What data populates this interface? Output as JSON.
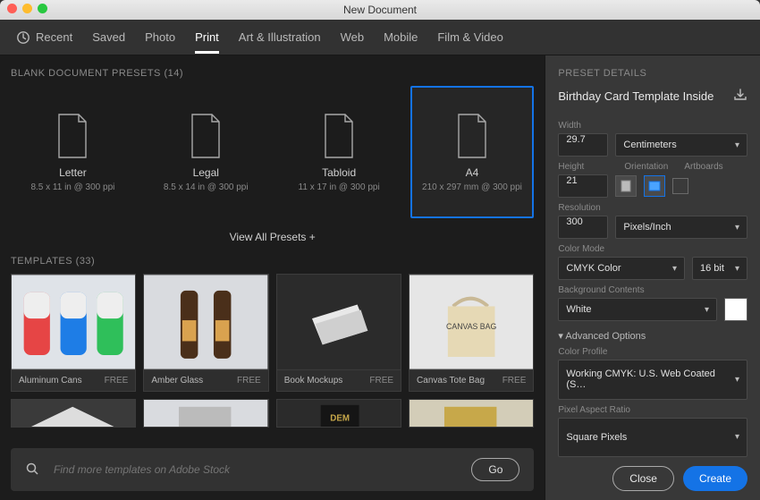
{
  "window": {
    "title": "New Document"
  },
  "tabs": {
    "recent": "Recent",
    "saved": "Saved",
    "photo": "Photo",
    "print": "Print",
    "art": "Art & Illustration",
    "web": "Web",
    "mobile": "Mobile",
    "film": "Film & Video",
    "active": "print"
  },
  "presets_section": {
    "title": "BLANK DOCUMENT PRESETS",
    "count": "(14)"
  },
  "presets": [
    {
      "name": "Letter",
      "spec": "8.5 x 11 in @ 300 ppi",
      "selected": false
    },
    {
      "name": "Legal",
      "spec": "8.5 x 14 in @ 300 ppi",
      "selected": false
    },
    {
      "name": "Tabloid",
      "spec": "11 x 17 in @ 300 ppi",
      "selected": false
    },
    {
      "name": "A4",
      "spec": "210 x 297 mm @ 300 ppi",
      "selected": true
    }
  ],
  "view_all": "View All Presets +",
  "templates_section": {
    "title": "TEMPLATES",
    "count": "(33)"
  },
  "templates": [
    {
      "name": "Aluminum Cans Moc…",
      "price": "FREE"
    },
    {
      "name": "Amber Glass Bottles…",
      "price": "FREE"
    },
    {
      "name": "Book Mockups",
      "price": "FREE"
    },
    {
      "name": "Canvas Tote Bag Mo…",
      "price": "FREE"
    }
  ],
  "search": {
    "placeholder": "Find more templates on Adobe Stock",
    "go": "Go"
  },
  "details": {
    "heading": "PRESET DETAILS",
    "name": "Birthday Card Template Inside",
    "width_label": "Width",
    "width_value": "29.7",
    "units": "Centimeters",
    "height_label": "Height",
    "height_value": "21",
    "orientation_label": "Orientation",
    "artboards_label": "Artboards",
    "resolution_label": "Resolution",
    "resolution_value": "300",
    "resolution_units": "Pixels/Inch",
    "colormode_label": "Color Mode",
    "colormode_value": "CMYK Color",
    "bitdepth_value": "16 bit",
    "bg_label": "Background Contents",
    "bg_value": "White",
    "adv_label": "Advanced Options",
    "profile_label": "Color Profile",
    "profile_value": "Working CMYK: U.S. Web Coated (S…",
    "par_label": "Pixel Aspect Ratio",
    "par_value": "Square Pixels"
  },
  "buttons": {
    "close": "Close",
    "create": "Create"
  }
}
